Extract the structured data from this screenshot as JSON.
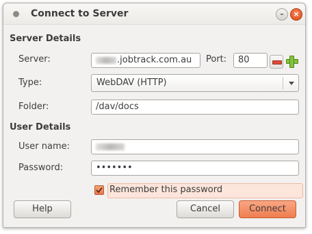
{
  "window": {
    "title": "Connect to Server",
    "minimize_glyph": "–",
    "close_glyph": "×"
  },
  "server_details": {
    "heading": "Server Details",
    "server_label": "Server:",
    "server_value": ".jobtrack.com.au",
    "port_label": "Port:",
    "port_value": "80",
    "type_label": "Type:",
    "type_value": "WebDAV (HTTP)",
    "folder_label": "Folder:",
    "folder_value": "/dav/docs"
  },
  "user_details": {
    "heading": "User Details",
    "username_label": "User name:",
    "password_label": "Password:",
    "password_value": "•••••••",
    "remember_label": "Remember this password",
    "remember_checked": true
  },
  "buttons": {
    "help": "Help",
    "cancel": "Cancel",
    "connect": "Connect"
  },
  "colors": {
    "accent": "#ef7d50",
    "remove": "#d94b38",
    "add": "#84c13d"
  }
}
